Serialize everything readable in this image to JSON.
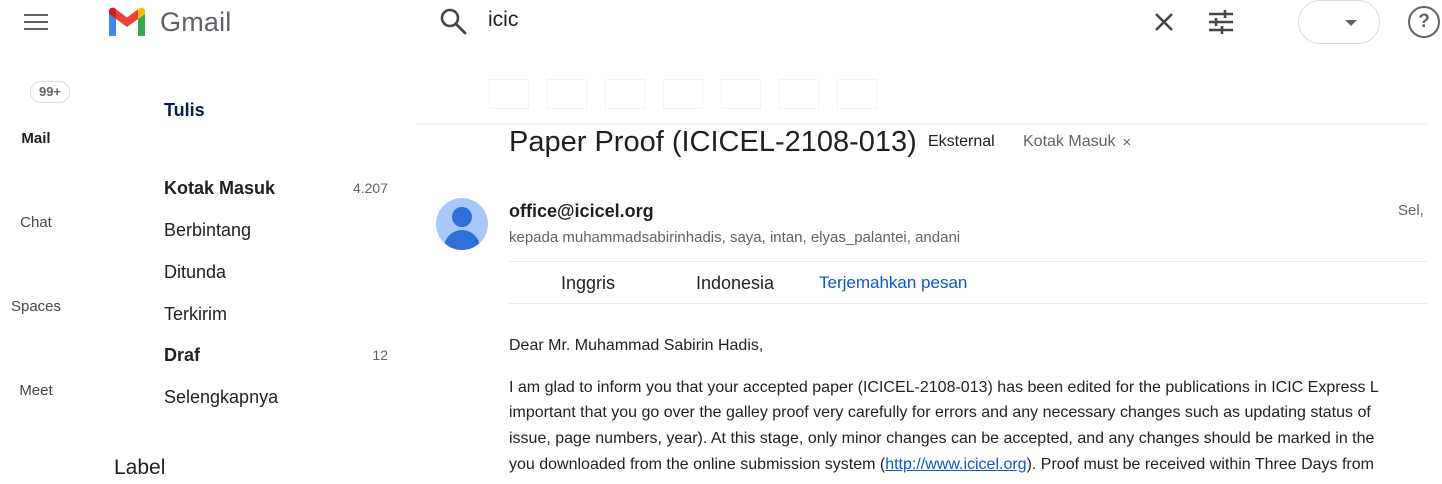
{
  "header": {
    "app_name": "Gmail",
    "search_value": "icic",
    "help_glyph": "?"
  },
  "rail": {
    "badge": "99+",
    "items": [
      "Mail",
      "Chat",
      "Spaces",
      "Meet"
    ]
  },
  "nav": {
    "compose": "Tulis",
    "items": [
      {
        "label": "Kotak Masuk",
        "count": "4.207"
      },
      {
        "label": "Berbintang",
        "count": ""
      },
      {
        "label": "Ditunda",
        "count": ""
      },
      {
        "label": "Terkirim",
        "count": ""
      },
      {
        "label": "Draf",
        "count": "12"
      },
      {
        "label": "Selengkapnya",
        "count": ""
      }
    ],
    "label_heading": "Label"
  },
  "email": {
    "subject": "Paper Proof (ICICEL-2108-013)",
    "tags": {
      "external": "Eksternal",
      "inbox": "Kotak Masuk",
      "remove_glyph": "×"
    },
    "sender": "office@icicel.org",
    "recipients": "kepada muhammadsabirinhadis, saya, intan, elyas_palantei, andani",
    "date": "Sel,",
    "translation": {
      "from": "Inggris",
      "to": "Indonesia",
      "action": "Terjemahkan pesan"
    },
    "greeting": "Dear Mr. Muhammad Sabirin Hadis,",
    "body": {
      "line1": "I am glad to inform you that your accepted paper (ICICEL-2108-013) has been edited for the publications in ICIC Express L",
      "line2": "important that you go over the galley proof very carefully for errors and any necessary changes such as updating status of",
      "line3": "issue, page numbers, year). At this stage, only minor changes can be accepted, and any changes should be marked in the",
      "line4_pre": "you downloaded from the online submission system (",
      "line4_link": "http://www.icicel.org",
      "line4_post": "). Proof must be received within Three Days from"
    }
  },
  "colors": {
    "accent": "#0b57d0",
    "compose_text": "#041e49",
    "avatar_bg": "#a8c7fa",
    "avatar_fg": "#2f6fd8"
  }
}
